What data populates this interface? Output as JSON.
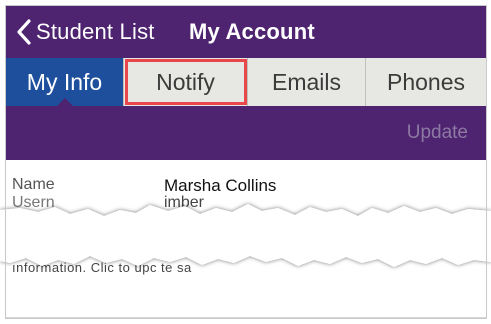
{
  "navbar": {
    "back_label": "Student List",
    "title": "My Account",
    "background": "#4e2370"
  },
  "tabs": [
    {
      "label": "My Info",
      "active": true
    },
    {
      "label": "Notify",
      "active": false,
      "highlighted": true
    },
    {
      "label": "Emails",
      "active": false
    },
    {
      "label": "Phones",
      "active": false
    }
  ],
  "actionbar": {
    "update_label": "Update"
  },
  "info": {
    "name_label": "Name",
    "name_value": "Marsha Collins",
    "row2_label": "Usern",
    "row2_value": "imber",
    "partial_text": "ınformation. Clic  to upc  te                    sa"
  },
  "colors": {
    "accent_purple": "#4e2370",
    "active_tab_blue": "#1d4f9c",
    "highlight_red": "#e8474c",
    "tab_bg": "#e7e8e3"
  },
  "icons": {
    "back": "chevron-left-icon"
  }
}
